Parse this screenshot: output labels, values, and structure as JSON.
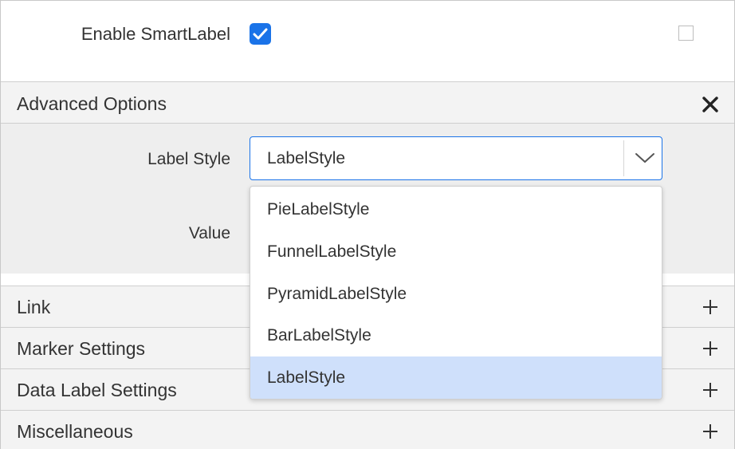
{
  "smart_label": {
    "label": "Enable SmartLabel",
    "checked": true
  },
  "advanced": {
    "title": "Advanced Options",
    "label_style_label": "Label Style",
    "label_style_value": "LabelStyle",
    "value_label": "Value"
  },
  "dropdown": {
    "options": [
      "PieLabelStyle",
      "FunnelLabelStyle",
      "PyramidLabelStyle",
      "BarLabelStyle",
      "LabelStyle"
    ],
    "selected": "LabelStyle"
  },
  "sections": [
    {
      "title": "Link"
    },
    {
      "title": "Marker Settings"
    },
    {
      "title": "Data Label Settings"
    },
    {
      "title": "Miscellaneous"
    }
  ],
  "colors": {
    "accent": "#1a73e8",
    "selected_option": "#cfe0fb",
    "header_bg": "#f3f3f3"
  }
}
